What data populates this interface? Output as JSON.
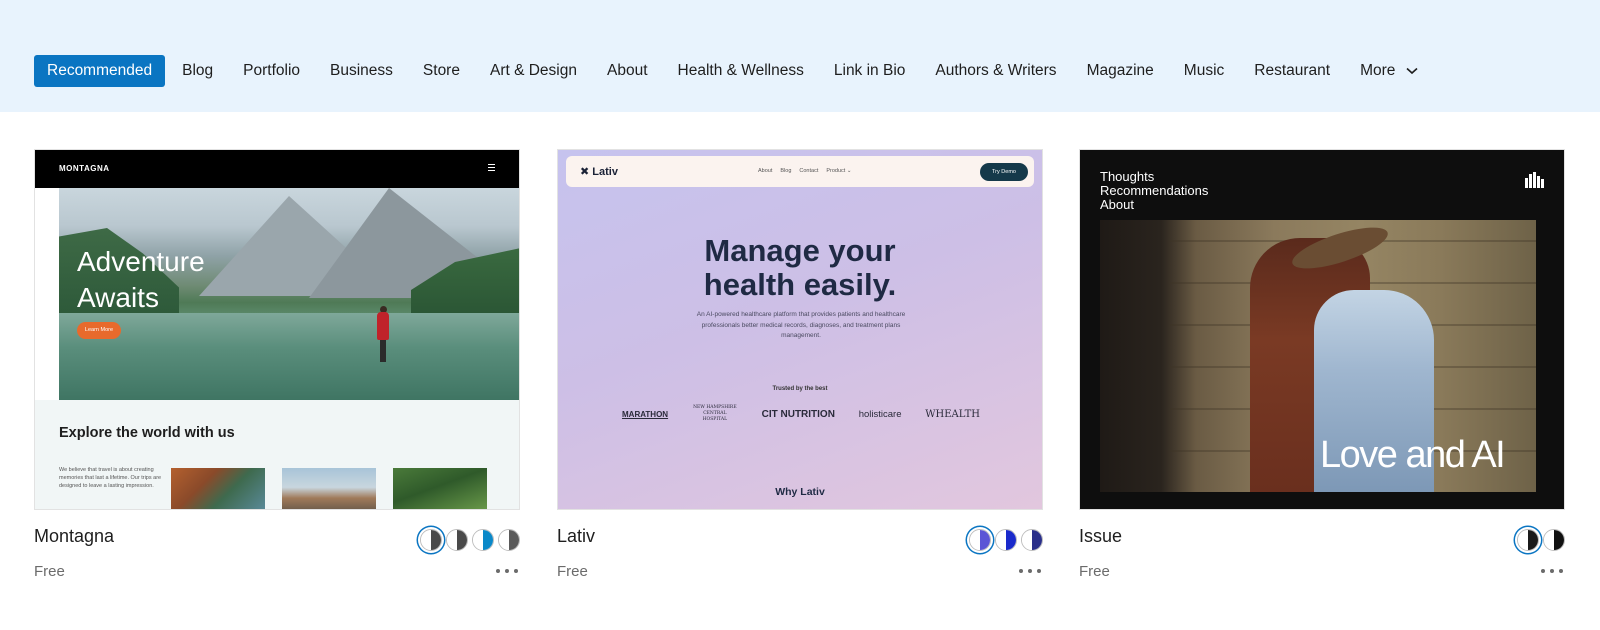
{
  "categories": {
    "items": [
      "Recommended",
      "Blog",
      "Portfolio",
      "Business",
      "Store",
      "Art & Design",
      "About",
      "Health & Wellness",
      "Link in Bio",
      "Authors & Writers",
      "Magazine",
      "Music",
      "Restaurant"
    ],
    "more_label": "More",
    "active_index": 0,
    "accent": "#0a75c2",
    "bar_background": "#e8f3fd"
  },
  "themes": [
    {
      "name": "Montagna",
      "price": "Free",
      "preview": {
        "brand": "MONTAGNA",
        "hero_title": "Adventure Awaits",
        "hero_button": "Learn More",
        "section_title": "Explore the world with us",
        "paragraph": "We believe that travel is about creating memories that last a lifetime. Our trips are designed to leave a lasting impression."
      },
      "style_variations": [
        {
          "left": "#ffffff",
          "right": "#4a4a4a",
          "selected": true
        },
        {
          "left": "#ffffff",
          "right": "#4a4a4a",
          "selected": false
        },
        {
          "left": "#ffffff",
          "right": "#0a88c8",
          "selected": false
        },
        {
          "left": "#ffffff",
          "right": "#5a5a5a",
          "selected": false
        }
      ]
    },
    {
      "name": "Lativ",
      "price": "Free",
      "preview": {
        "brand": "Lativ",
        "nav_links": [
          "About",
          "Blog",
          "Contact",
          "Product ⌄"
        ],
        "cta": "Try Demo",
        "headline": "Manage your health easily.",
        "paragraph": "An AI-powered healthcare platform that provides patients and healthcare professionals better medical records, diagnoses, and treatment plans management.",
        "trusted_label": "Trusted by the best",
        "brands": [
          "MARATHON",
          "NEW HAMPSHIRE CENTRAL HOSPITAL",
          "CIT NUTRITION",
          "holisticare",
          "WHEALTH"
        ],
        "section_title": "Why Lativ"
      },
      "style_variations": [
        {
          "left": "#ffffff",
          "right": "#5b55d6",
          "selected": true
        },
        {
          "left": "#ffffff",
          "right": "#1a2acb",
          "selected": false
        },
        {
          "left": "#ffffff",
          "right": "#2a2f8a",
          "selected": false
        }
      ]
    },
    {
      "name": "Issue",
      "price": "Free",
      "preview": {
        "menu": [
          "Thoughts",
          "Recommendations",
          "About"
        ],
        "hero_title": "Love and AI"
      },
      "style_variations": [
        {
          "left": "#ffffff",
          "right": "#1a1a1a",
          "selected": true
        },
        {
          "left": "#ffffff",
          "right": "#111111",
          "selected": false
        }
      ]
    }
  ]
}
